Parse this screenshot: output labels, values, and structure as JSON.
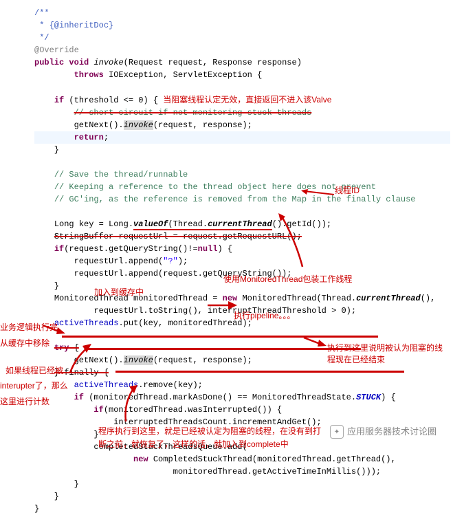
{
  "code": {
    "doc1": "/**",
    "doc2": " * {@inheritDoc}",
    "doc3": " */",
    "override": "@Override",
    "sig_public": "public",
    "sig_void": "void",
    "sig_invoke": "invoke",
    "sig_params": "(Request request, Response response)",
    "throws_kw": "throws",
    "throws_ex": " IOException, ServletException {",
    "if_kw": "if",
    "threshold_cond": " (threshold <= 0) { ",
    "shortcircuit": "// short-circuit if not monitoring stuck threads",
    "getnext1": "getNext().",
    "invoke_hl": "invoke",
    "getnext1_args": "(request, response);",
    "return_kw": "return",
    "return_semi": ";",
    "save_comment": "// Save the thread/runnable",
    "keep_comment": "// Keeping a reference to the thread object here does not prevent",
    "gc_comment": "// GC'ing, as the reference is removed from the Map in the finally clause",
    "long_decl": "Long key = Long.",
    "valueOf": "valueOf",
    "thread_curr": "(Thread.",
    "currentThread": "currentThread",
    "getId": "().getId());",
    "sb_decl": "StringBuffer requestUrl = request.getRequestURL();",
    "if_qs": "(request.getQueryString()!=",
    "null_kw": "null",
    "if_qs_end": ") {",
    "append_q": "requestUrl.append(",
    "q_str": "\"?\"",
    "append_q_end": ");",
    "append_qs": "requestUrl.append(request.getQueryString());",
    "mt_decl": "MonitoredThread monitoredThread = ",
    "new_kw": "new",
    "mt_ctor": " MonitoredThread(Thread.",
    "mt_ctor2": "(),",
    "mt_line2": "requestUrl.toString(), interruptThreadThreshold > 0);",
    "at_put": "activeThreads",
    "at_put_args": ".put(key, monitoredThread);",
    "try_kw": "try",
    "try_brace": " {",
    "getnext2": "getNext().",
    "getnext2_args": "(request, response);",
    "finally_kw": "} finally {",
    "at_remove": ".remove(key);",
    "if_mark": " (monitoredThread.markAsDone() == MonitoredThreadState.",
    "stuck": "STUCK",
    "stuck_end": ") {",
    "if_interrupted": "(monitoredThread.wasInterrupted()) {",
    "itc_inc": "interruptedThreadsCount.incrementAndGet();",
    "cstq_add": "completedStuckThreadsQueue.add(",
    "cst_ctor": " CompletedStuckThread(monitoredThread.getThread(),",
    "getatim": "monitoredThread.getActiveTimeInMillis()));"
  },
  "annotations": {
    "a1": "当阻塞线程认定无效，直接返回不进入该Valve",
    "a2": "线程ID",
    "a3": "使用MonitoredThread包装工作线程",
    "a4": "加入到缓存中",
    "a5": "执行pipeline。。。",
    "a6": "业务逻辑执行完",
    "a7": "从缓存中移除",
    "a8": "如果线程已经被",
    "a8b": "interupter了，那么",
    "a8c": "这里进行计数",
    "a9": "执行到这里说明被认为阻塞的线",
    "a9b": "程现在已经结束",
    "a10": "程序执行到这里，就是已经被认定为阻塞的线程，在没有到打",
    "a10b": "断之前，就恢复了，这样的话，就加入到complete中"
  },
  "watermark": "应用服务器技术讨论圈"
}
